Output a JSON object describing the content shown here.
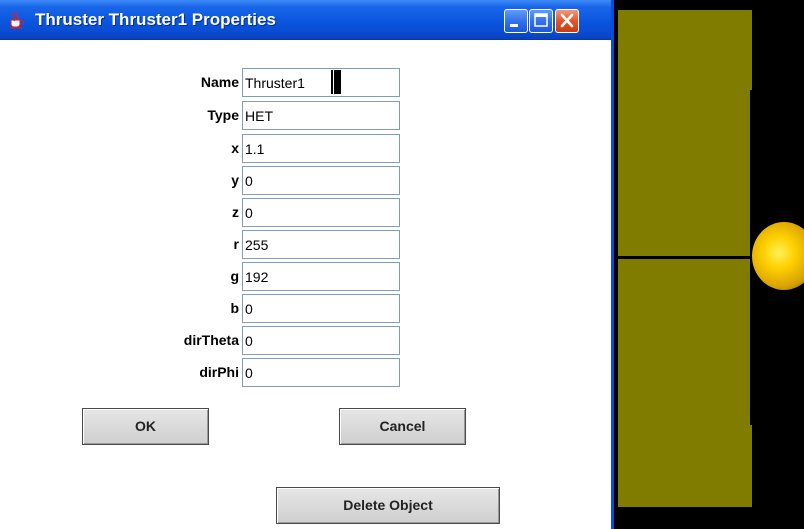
{
  "window": {
    "title": "Thruster Thruster1 Properties",
    "icon": "java-coffee-cup-icon",
    "controls": [
      "minimize-icon",
      "maximize-icon",
      "close-icon"
    ]
  },
  "form": {
    "fields": [
      {
        "label": "Name",
        "value": "Thruster1"
      },
      {
        "label": "Type",
        "value": "HET"
      },
      {
        "label": "x",
        "value": "1.1"
      },
      {
        "label": "y",
        "value": "0"
      },
      {
        "label": "z",
        "value": "0"
      },
      {
        "label": "r",
        "value": "255"
      },
      {
        "label": "g",
        "value": "192"
      },
      {
        "label": "b",
        "value": "0"
      },
      {
        "label": "dirTheta",
        "value": "0"
      },
      {
        "label": "dirPhi",
        "value": "0"
      }
    ]
  },
  "buttons": {
    "ok": "OK",
    "cancel": "Cancel",
    "delete": "Delete Object"
  },
  "colors": {
    "titlebar": "#0a56df",
    "panel": "#7f7c00",
    "thruster": "#ffc000",
    "viewport_bg": "#000000"
  }
}
